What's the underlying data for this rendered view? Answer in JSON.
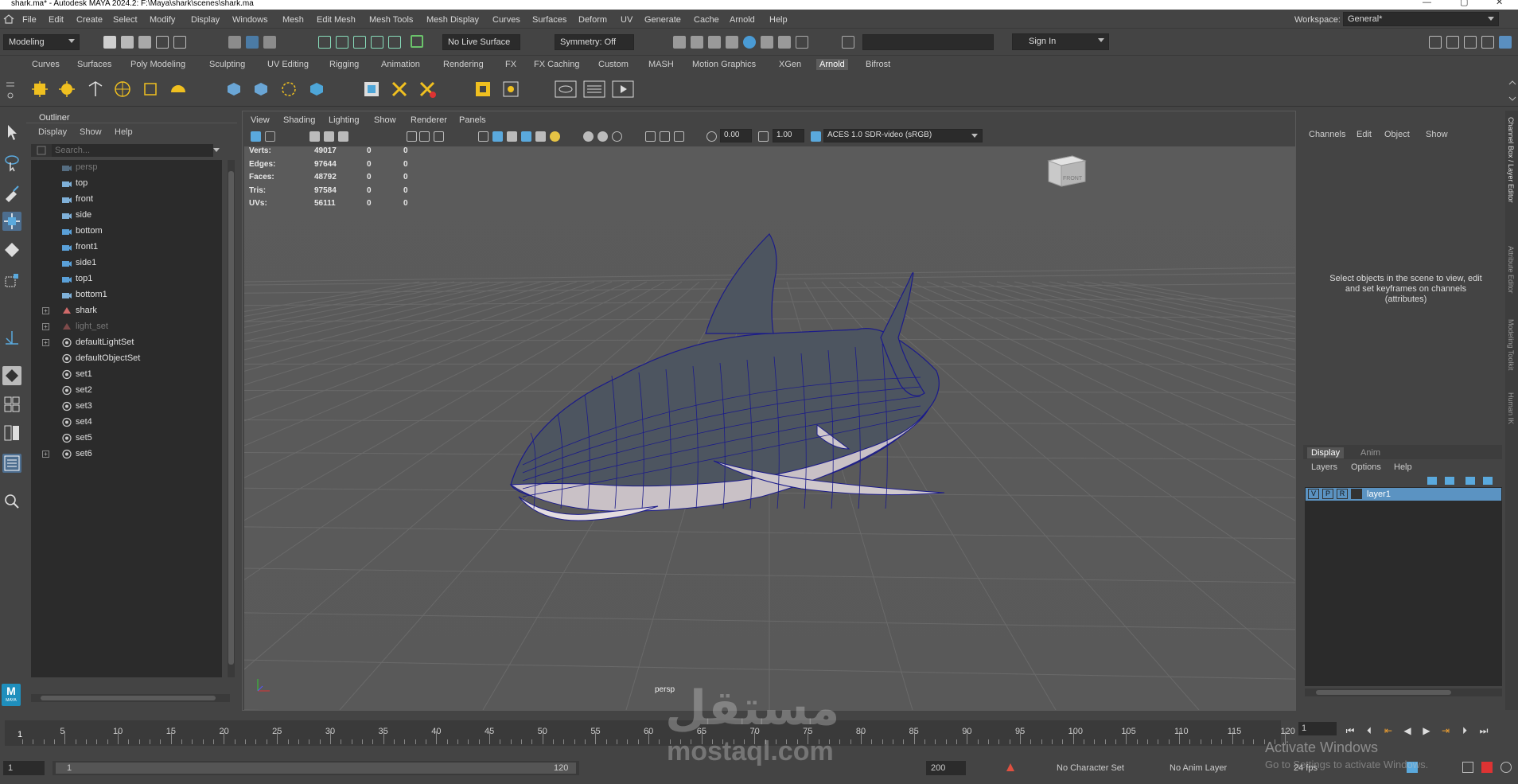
{
  "window": {
    "title": "shark.ma* - Autodesk MAYA 2024.2: F:\\Maya\\shark\\scenes\\shark.ma"
  },
  "menus": [
    "File",
    "Edit",
    "Create",
    "Select",
    "Modify",
    "Display",
    "Windows",
    "Mesh",
    "Edit Mesh",
    "Mesh Tools",
    "Mesh Display",
    "Curves",
    "Surfaces",
    "Deform",
    "UV",
    "Generate",
    "Cache",
    "Arnold",
    "Help"
  ],
  "workspace": {
    "label": "Workspace:",
    "value": "General*"
  },
  "status": {
    "mode": "Modeling",
    "live_surface": "No Live Surface",
    "symmetry": "Symmetry: Off",
    "sign_in": "Sign In"
  },
  "shelf_tabs": [
    "Curves",
    "Surfaces",
    "Poly Modeling",
    "Sculpting",
    "UV Editing",
    "Rigging",
    "Animation",
    "Rendering",
    "FX",
    "FX Caching",
    "Custom",
    "MASH",
    "Motion Graphics",
    "XGen",
    "Arnold",
    "Bifrost"
  ],
  "shelf_active": "Arnold",
  "outliner": {
    "title": "Outliner",
    "menu": [
      "Display",
      "Show",
      "Help"
    ],
    "search_placeholder": "Search...",
    "items": [
      {
        "label": "persp",
        "type": "camera",
        "dim": true,
        "expand": false
      },
      {
        "label": "top",
        "type": "camera",
        "dim": false,
        "expand": false
      },
      {
        "label": "front",
        "type": "camera",
        "dim": false,
        "expand": false
      },
      {
        "label": "side",
        "type": "camera",
        "dim": false,
        "expand": false
      },
      {
        "label": "bottom",
        "type": "camera2",
        "dim": false,
        "expand": false
      },
      {
        "label": "front1",
        "type": "camera2",
        "dim": false,
        "expand": false
      },
      {
        "label": "side1",
        "type": "camera2",
        "dim": false,
        "expand": false
      },
      {
        "label": "top1",
        "type": "camera2",
        "dim": false,
        "expand": false
      },
      {
        "label": "bottom1",
        "type": "camera",
        "dim": false,
        "expand": false
      },
      {
        "label": "shark",
        "type": "mesh",
        "dim": false,
        "expand": true
      },
      {
        "label": "light_set",
        "type": "mesh",
        "dim": true,
        "expand": true
      },
      {
        "label": "defaultLightSet",
        "type": "set",
        "dim": false,
        "expand": true
      },
      {
        "label": "defaultObjectSet",
        "type": "set",
        "dim": false,
        "expand": false
      },
      {
        "label": "set1",
        "type": "set",
        "dim": false,
        "expand": false
      },
      {
        "label": "set2",
        "type": "set",
        "dim": false,
        "expand": false
      },
      {
        "label": "set3",
        "type": "set",
        "dim": false,
        "expand": false
      },
      {
        "label": "set4",
        "type": "set",
        "dim": false,
        "expand": false
      },
      {
        "label": "set5",
        "type": "set",
        "dim": false,
        "expand": false
      },
      {
        "label": "set6",
        "type": "set",
        "dim": false,
        "expand": true
      }
    ]
  },
  "viewport": {
    "menu": [
      "View",
      "Shading",
      "Lighting",
      "Show",
      "Renderer",
      "Panels"
    ],
    "exposure": "0.00",
    "gamma": "1.00",
    "color_space": "ACES 1.0 SDR-video (sRGB)",
    "hud": [
      {
        "label": "Verts:",
        "values": [
          "49017",
          "0",
          "0"
        ]
      },
      {
        "label": "Edges:",
        "values": [
          "97644",
          "0",
          "0"
        ]
      },
      {
        "label": "Faces:",
        "values": [
          "48792",
          "0",
          "0"
        ]
      },
      {
        "label": "Tris:",
        "values": [
          "97584",
          "0",
          "0"
        ]
      },
      {
        "label": "UVs:",
        "values": [
          "56111",
          "0",
          "0"
        ]
      }
    ],
    "camera_label": "persp",
    "viewcube_label": "FRONT"
  },
  "channel_box": {
    "menu": [
      "Channels",
      "Edit",
      "Object",
      "Show"
    ],
    "message": "Select objects in the scene to view, edit and set keyframes on channels (attributes)",
    "side_tabs": [
      "Channel Box / Layer Editor",
      "Attribute Editor",
      "Modeling Toolkit",
      "Human IK"
    ]
  },
  "layer_editor": {
    "tabs": [
      "Display",
      "Anim"
    ],
    "menu": [
      "Layers",
      "Options",
      "Help"
    ],
    "layer": {
      "v": "V",
      "p": "P",
      "r": "R",
      "name": "layer1"
    }
  },
  "timeline": {
    "ticks": [
      "5",
      "10",
      "15",
      "20",
      "25",
      "30",
      "35",
      "40",
      "45",
      "50",
      "55",
      "60",
      "65",
      "70",
      "75",
      "80",
      "85",
      "90",
      "95",
      "100",
      "105",
      "110",
      "115",
      "120"
    ],
    "current_frame": "1",
    "frame_field": "1"
  },
  "range": {
    "start": "1",
    "inner_start": "1",
    "inner_end": "120",
    "end": "200",
    "char_set": "No Character Set",
    "anim_layer": "No Anim Layer",
    "fps": "24 fps"
  },
  "watermarks": {
    "activate_title": "Activate Windows",
    "activate_sub": "Go to Settings to activate Windows.",
    "site_arabic": "مستقل",
    "site_latin": "mostaql.com"
  },
  "maya_logo": {
    "letter": "M",
    "word": "MAYA"
  }
}
